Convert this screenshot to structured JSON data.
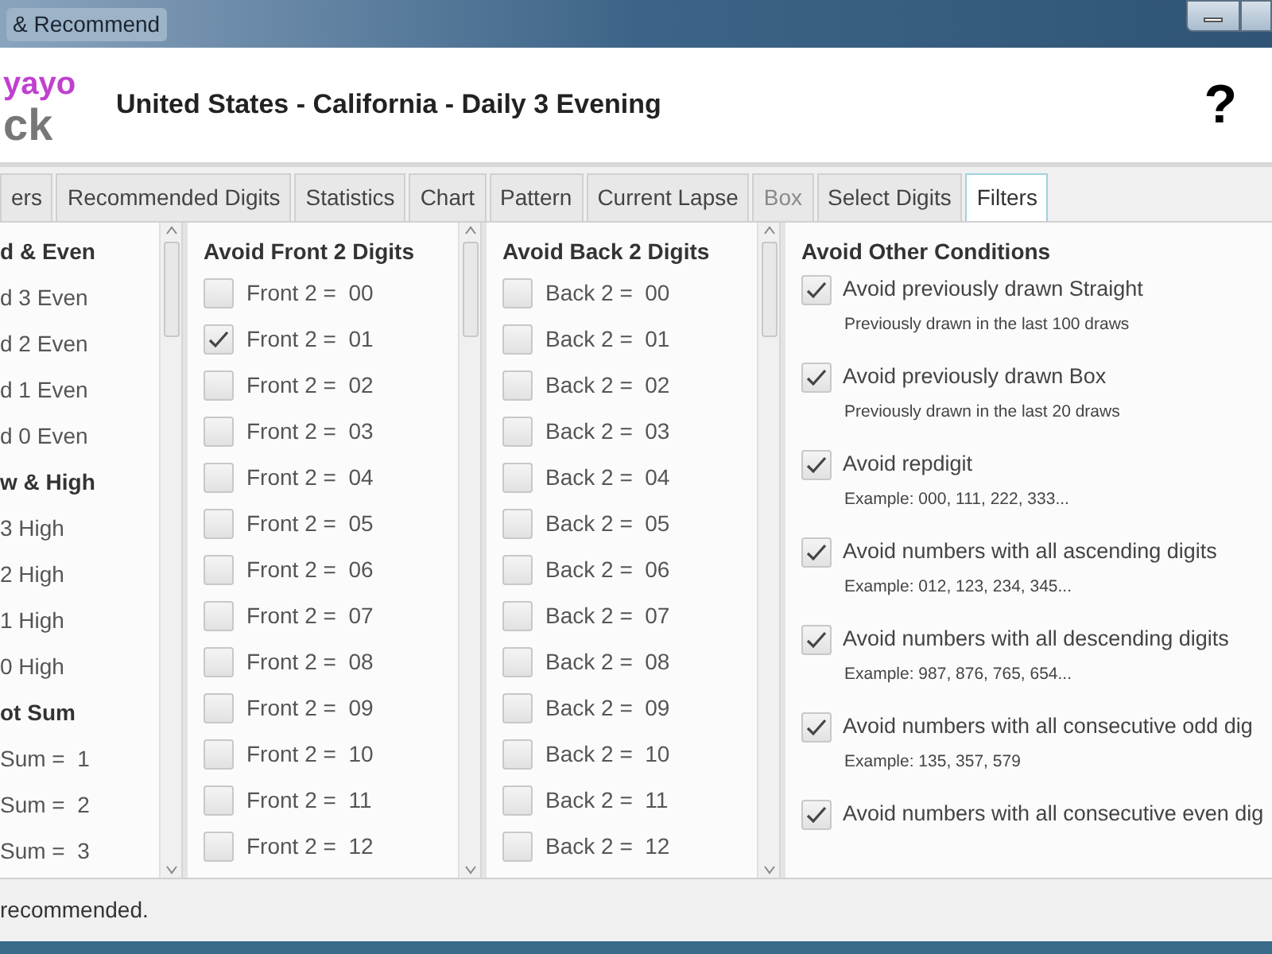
{
  "window": {
    "title": "& Recommend"
  },
  "header": {
    "logo_top": "yayo",
    "logo_bottom": "ck",
    "title": "United States - California - Daily 3 Evening",
    "help": "?"
  },
  "tabs": [
    {
      "label": "ers",
      "selected": false,
      "disabled": false
    },
    {
      "label": "Recommended Digits",
      "selected": false,
      "disabled": false
    },
    {
      "label": "Statistics",
      "selected": false,
      "disabled": false
    },
    {
      "label": "Chart",
      "selected": false,
      "disabled": false
    },
    {
      "label": "Pattern",
      "selected": false,
      "disabled": false
    },
    {
      "label": "Current Lapse",
      "selected": false,
      "disabled": false
    },
    {
      "label": "Box",
      "selected": false,
      "disabled": true
    },
    {
      "label": "Select Digits",
      "selected": false,
      "disabled": false
    },
    {
      "label": "Filters",
      "selected": true,
      "disabled": false
    }
  ],
  "left_panel": {
    "items": [
      {
        "kind": "heading",
        "label": "d & Even"
      },
      {
        "kind": "option",
        "label": "d 3 Even"
      },
      {
        "kind": "option",
        "label": "d 2 Even"
      },
      {
        "kind": "option",
        "label": "d 1 Even"
      },
      {
        "kind": "option",
        "label": "d 0 Even"
      },
      {
        "kind": "heading",
        "label": "w & High"
      },
      {
        "kind": "option",
        "label": "3 High"
      },
      {
        "kind": "option",
        "label": "2 High"
      },
      {
        "kind": "option",
        "label": "1 High"
      },
      {
        "kind": "option",
        "label": "0 High"
      },
      {
        "kind": "heading",
        "label": "ot Sum"
      },
      {
        "kind": "option",
        "label": "Sum =  1"
      },
      {
        "kind": "option",
        "label": "Sum =  2"
      },
      {
        "kind": "option",
        "label": "Sum =  3"
      }
    ]
  },
  "front_panel": {
    "heading": "Avoid Front 2 Digits",
    "options": [
      {
        "label": "Front 2 =  00",
        "checked": false
      },
      {
        "label": "Front 2 =  01",
        "checked": true
      },
      {
        "label": "Front 2 =  02",
        "checked": false
      },
      {
        "label": "Front 2 =  03",
        "checked": false
      },
      {
        "label": "Front 2 =  04",
        "checked": false
      },
      {
        "label": "Front 2 =  05",
        "checked": false
      },
      {
        "label": "Front 2 =  06",
        "checked": false
      },
      {
        "label": "Front 2 =  07",
        "checked": false
      },
      {
        "label": "Front 2 =  08",
        "checked": false
      },
      {
        "label": "Front 2 =  09",
        "checked": false
      },
      {
        "label": "Front 2 =  10",
        "checked": false
      },
      {
        "label": "Front 2 =  11",
        "checked": false
      },
      {
        "label": "Front 2 =  12",
        "checked": false
      }
    ]
  },
  "back_panel": {
    "heading": "Avoid Back 2 Digits",
    "options": [
      {
        "label": "Back 2 =  00",
        "checked": false
      },
      {
        "label": "Back 2 =  01",
        "checked": false
      },
      {
        "label": "Back 2 =  02",
        "checked": false
      },
      {
        "label": "Back 2 =  03",
        "checked": false
      },
      {
        "label": "Back 2 =  04",
        "checked": false
      },
      {
        "label": "Back 2 =  05",
        "checked": false
      },
      {
        "label": "Back 2 =  06",
        "checked": false
      },
      {
        "label": "Back 2 =  07",
        "checked": false
      },
      {
        "label": "Back 2 =  08",
        "checked": false
      },
      {
        "label": "Back 2 =  09",
        "checked": false
      },
      {
        "label": "Back 2 =  10",
        "checked": false
      },
      {
        "label": "Back 2 =  11",
        "checked": false
      },
      {
        "label": "Back 2 =  12",
        "checked": false
      }
    ]
  },
  "other_panel": {
    "heading": "Avoid Other Conditions",
    "options": [
      {
        "label": "Avoid previously drawn Straight",
        "checked": true,
        "note": "Previously drawn in the last 100 draws"
      },
      {
        "label": "Avoid previously drawn Box",
        "checked": true,
        "note": "Previously drawn in the last 20 draws"
      },
      {
        "label": "Avoid repdigit",
        "checked": true,
        "note": "Example: 000, 111, 222, 333..."
      },
      {
        "label": "Avoid numbers with all ascending digits",
        "checked": true,
        "note": "Example: 012, 123, 234, 345..."
      },
      {
        "label": "Avoid numbers with all descending digits",
        "checked": true,
        "note": "Example: 987, 876, 765, 654..."
      },
      {
        "label": "Avoid numbers with all consecutive odd dig",
        "checked": true,
        "note": "Example: 135, 357, 579"
      },
      {
        "label": "Avoid numbers with all consecutive even dig",
        "checked": true
      }
    ]
  },
  "status_bar": {
    "text": "recommended."
  }
}
